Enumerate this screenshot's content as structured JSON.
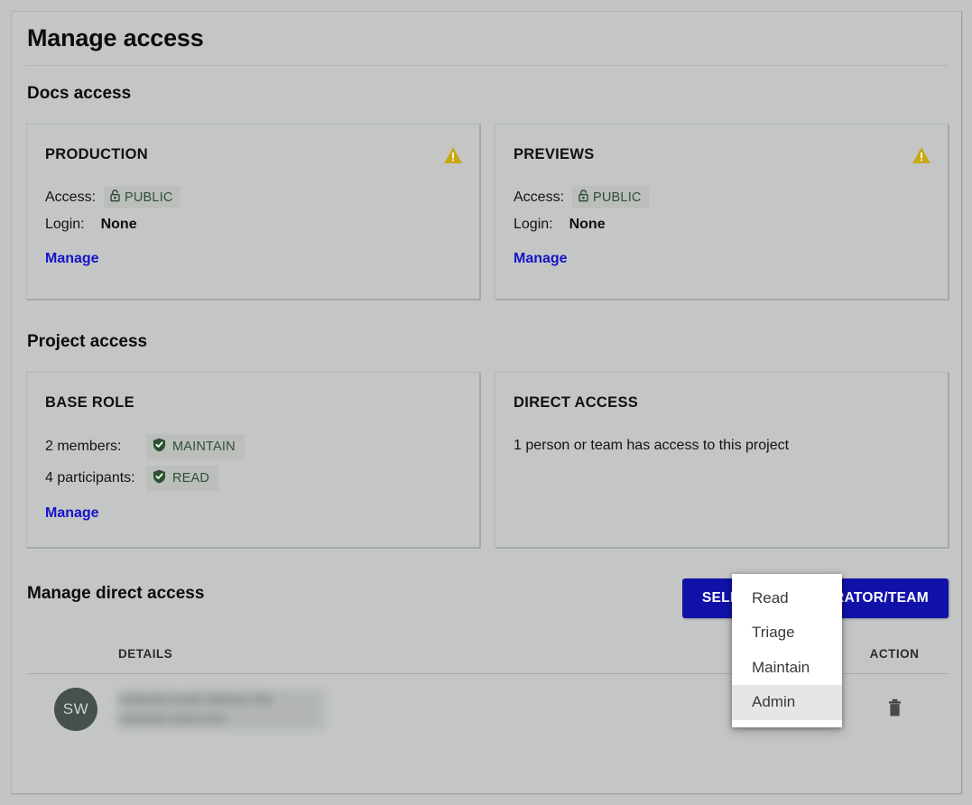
{
  "page": {
    "title": "Manage access"
  },
  "docs_access": {
    "heading": "Docs access",
    "cards": [
      {
        "title": "PRODUCTION",
        "warn_icon": "warning-triangle-icon",
        "access_label": "Access:",
        "access_value": "PUBLIC",
        "access_icon": "open-lock-icon",
        "login_label": "Login:",
        "login_value": "None",
        "manage_link": "Manage"
      },
      {
        "title": "PREVIEWS",
        "warn_icon": "warning-triangle-icon",
        "access_label": "Access:",
        "access_value": "PUBLIC",
        "access_icon": "open-lock-icon",
        "login_label": "Login:",
        "login_value": "None",
        "manage_link": "Manage"
      }
    ]
  },
  "project_access": {
    "heading": "Project access",
    "base_role": {
      "title": "BASE ROLE",
      "rows": [
        {
          "label": "2 members:",
          "badge": "MAINTAIN",
          "icon": "shield-check-icon"
        },
        {
          "label": "4 participants:",
          "badge": "READ",
          "icon": "shield-check-icon"
        }
      ],
      "manage_link": "Manage"
    },
    "direct_access": {
      "title": "DIRECT ACCESS",
      "summary": "1 person or team has access to this project"
    }
  },
  "manage_direct_access": {
    "heading": "Manage direct access",
    "select_button": "SELECT COLLABORATOR/TEAM",
    "columns": {
      "avatar": "",
      "details": "DETAILS",
      "action": "ACTION"
    },
    "rows": [
      {
        "initials": "SW",
        "details_line1": "redacted email address line",
        "details_line2": "redacted name line",
        "action_icon": "trash-icon"
      }
    ]
  },
  "role_dropdown": {
    "items": [
      {
        "label": "Read",
        "selected": false
      },
      {
        "label": "Triage",
        "selected": false
      },
      {
        "label": "Maintain",
        "selected": false
      },
      {
        "label": "Admin",
        "selected": true
      }
    ]
  },
  "colors": {
    "page_background": "#c3c5c5",
    "accent_blue": "#1111aa",
    "link_blue": "#1414c8",
    "warning_yellow": "#c8a914",
    "badge_green": "#2f4f37",
    "avatar_background": "#46514f"
  }
}
